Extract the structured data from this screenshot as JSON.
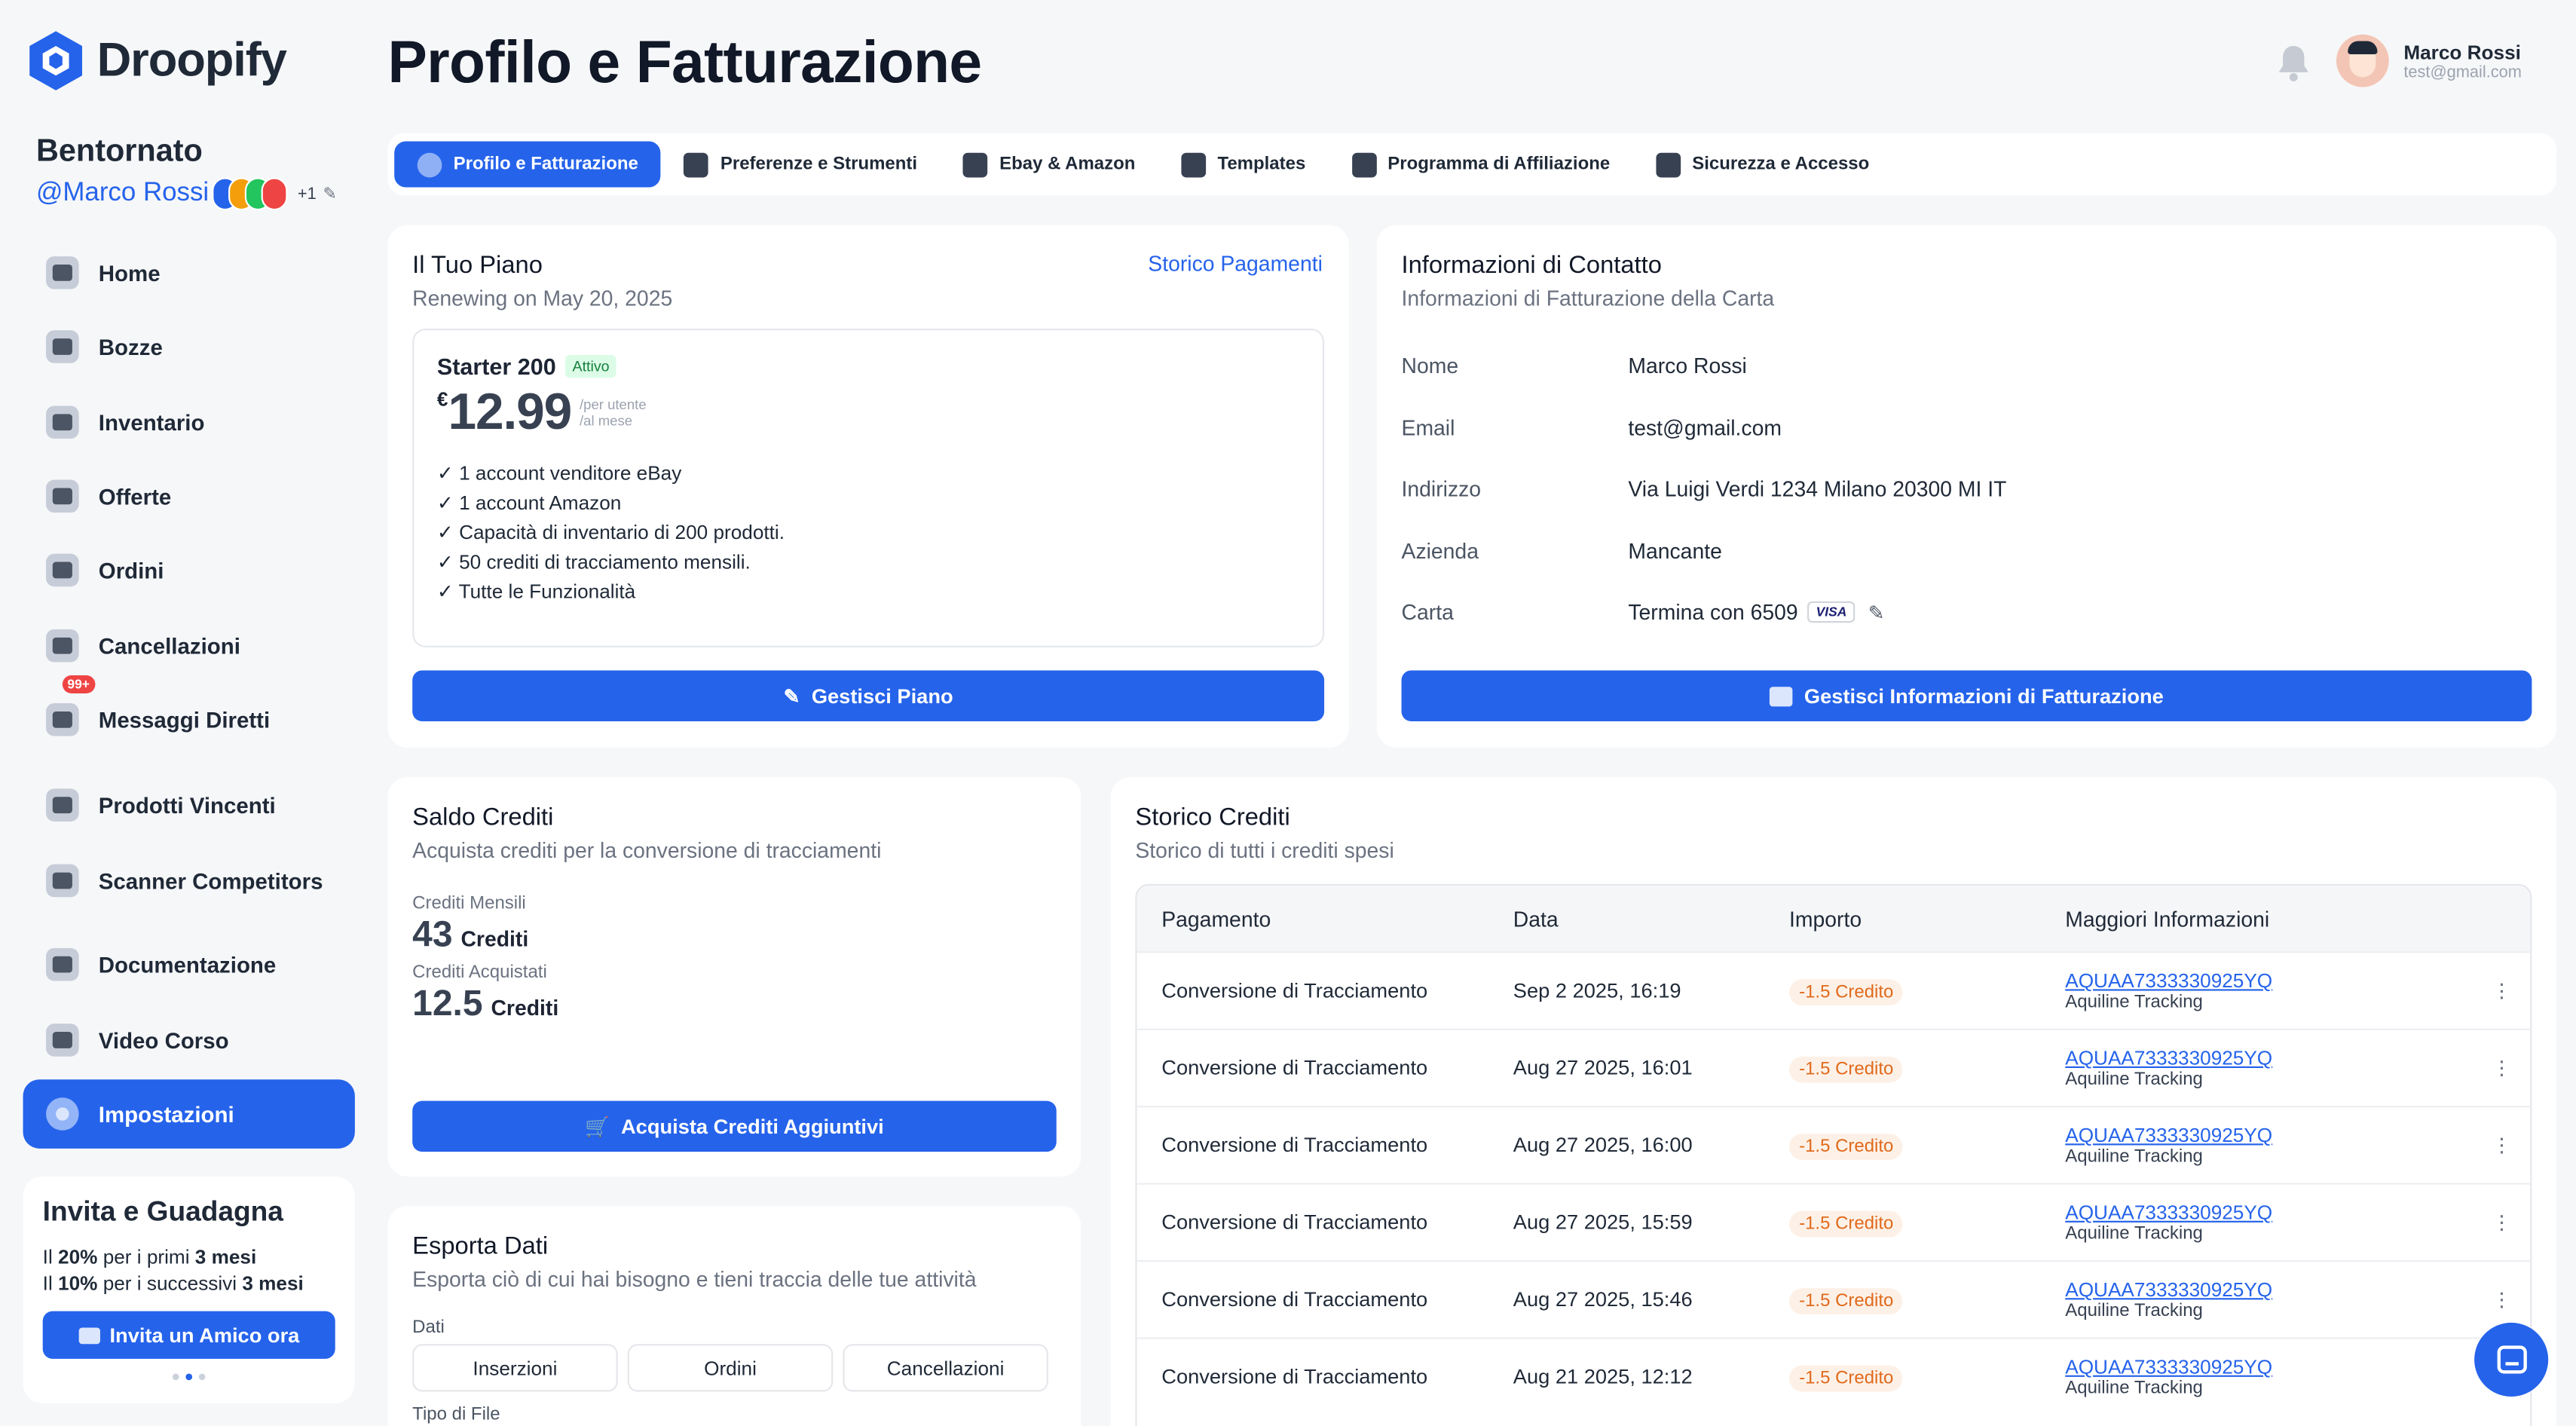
{
  "brand": {
    "name": "Droopify",
    "accent": "#2563eb"
  },
  "sidebar": {
    "welcome": "Bentornato",
    "handle": "@Marco Rossi",
    "extra_count": "+1",
    "items": [
      {
        "label": "Home",
        "icon": "home-icon"
      },
      {
        "label": "Bozze",
        "icon": "drafts-icon"
      },
      {
        "label": "Inventario",
        "icon": "briefcase-icon"
      },
      {
        "label": "Offerte",
        "icon": "percent-icon"
      },
      {
        "label": "Ordini",
        "icon": "cart-icon"
      },
      {
        "label": "Cancellazioni",
        "icon": "cancel-icon"
      },
      {
        "label": "Messaggi Diretti",
        "icon": "megaphone-icon",
        "badge": "99+"
      },
      {
        "label": "Prodotti Vincenti",
        "icon": "rocket-icon"
      },
      {
        "label": "Scanner Competitors",
        "icon": "scanner-icon"
      },
      {
        "label": "Documentazione",
        "icon": "document-icon"
      },
      {
        "label": "Video Corso",
        "icon": "book-icon"
      },
      {
        "label": "Impostazioni",
        "icon": "gear-icon",
        "active": true
      }
    ],
    "invite": {
      "title": "Invita e Guadagna",
      "line1_pre": "Il ",
      "line1_pct": "20%",
      "line1_mid": " per i primi ",
      "line1_dur": "3 mesi",
      "line2_pre": "Il ",
      "line2_pct": "10%",
      "line2_mid": " per i successivi ",
      "line2_dur": "3 mesi",
      "button": "Invita un Amico ora"
    }
  },
  "header": {
    "title": "Profilo e Fatturazione",
    "user_name": "Marco Rossi",
    "user_email": "test@gmail.com"
  },
  "tabs": [
    {
      "label": "Profilo e Fatturazione",
      "icon": "gear-icon",
      "active": true
    },
    {
      "label": "Preferenze e Strumenti",
      "icon": "tools-icon"
    },
    {
      "label": "Ebay & Amazon",
      "icon": "user-add-icon"
    },
    {
      "label": "Templates",
      "icon": "image-icon"
    },
    {
      "label": "Programma di Affiliazione",
      "icon": "users-icon"
    },
    {
      "label": "Sicurezza e Accesso",
      "icon": "lock-icon"
    }
  ],
  "plan": {
    "title": "Il Tuo Piano",
    "renew": "Renewing on May 20, 2025",
    "history_link": "Storico Pagamenti",
    "name": "Starter 200",
    "status": "Attivo",
    "currency": "€",
    "price": "12.99",
    "per1": "/per utente",
    "per2": "/al mese",
    "features": [
      "1 account venditore eBay",
      "1 account Amazon",
      "Capacità di inventario di 200 prodotti.",
      "50 crediti di tracciamento mensili.",
      "Tutte le Funzionalità"
    ],
    "button": "Gestisci Piano"
  },
  "contact": {
    "title": "Informazioni di Contatto",
    "subtitle": "Informazioni di Fatturazione della Carta",
    "rows": [
      {
        "k": "Nome",
        "v": "Marco Rossi"
      },
      {
        "k": "Email",
        "v": "test@gmail.com"
      },
      {
        "k": "Indirizzo",
        "v": "Via Luigi Verdi 1234 Milano 20300 MI IT"
      },
      {
        "k": "Azienda",
        "v": "Mancante"
      },
      {
        "k": "Carta",
        "v": "Termina con 6509"
      }
    ],
    "card_brand": "VISA",
    "button": "Gestisci Informazioni di Fatturazione"
  },
  "credits": {
    "title": "Saldo Crediti",
    "subtitle": "Acquista crediti per la conversione di tracciamenti",
    "monthly_label": "Crediti Mensili",
    "monthly_value": "43",
    "bought_label": "Crediti Acquistati",
    "bought_value": "12.5",
    "unit": "Crediti",
    "button": "Acquista Crediti Aggiuntivi"
  },
  "export": {
    "title": "Esporta Dati",
    "subtitle": "Esporta ciò di cui hai bisogno e tieni traccia delle tue attività",
    "data_label": "Dati",
    "options": [
      "Inserzioni",
      "Ordini",
      "Cancellazioni"
    ],
    "file_label": "Tipo di File"
  },
  "history": {
    "title": "Storico Crediti",
    "subtitle": "Storico di tutti i crediti spesi",
    "columns": [
      "Pagamento",
      "Data",
      "Importo",
      "Maggiori Informazioni"
    ],
    "rows": [
      {
        "payment": "Conversione di Tracciamento",
        "date": "Sep 2 2025, 16:19",
        "amount": "-1.5 Credito",
        "ref": "AQUAA7333330925YQ",
        "carrier": "Aquiline Tracking"
      },
      {
        "payment": "Conversione di Tracciamento",
        "date": "Aug 27 2025, 16:01",
        "amount": "-1.5 Credito",
        "ref": "AQUAA7333330925YQ",
        "carrier": "Aquiline Tracking"
      },
      {
        "payment": "Conversione di Tracciamento",
        "date": "Aug 27 2025, 16:00",
        "amount": "-1.5 Credito",
        "ref": "AQUAA7333330925YQ",
        "carrier": "Aquiline Tracking"
      },
      {
        "payment": "Conversione di Tracciamento",
        "date": "Aug 27 2025, 15:59",
        "amount": "-1.5 Credito",
        "ref": "AQUAA7333330925YQ",
        "carrier": "Aquiline Tracking"
      },
      {
        "payment": "Conversione di Tracciamento",
        "date": "Aug 27 2025, 15:46",
        "amount": "-1.5 Credito",
        "ref": "AQUAA7333330925YQ",
        "carrier": "Aquiline Tracking"
      },
      {
        "payment": "Conversione di Tracciamento",
        "date": "Aug 21 2025, 12:12",
        "amount": "-1.5 Credito",
        "ref": "AQUAA7333330925YQ",
        "carrier": "Aquiline Tracking"
      }
    ]
  }
}
